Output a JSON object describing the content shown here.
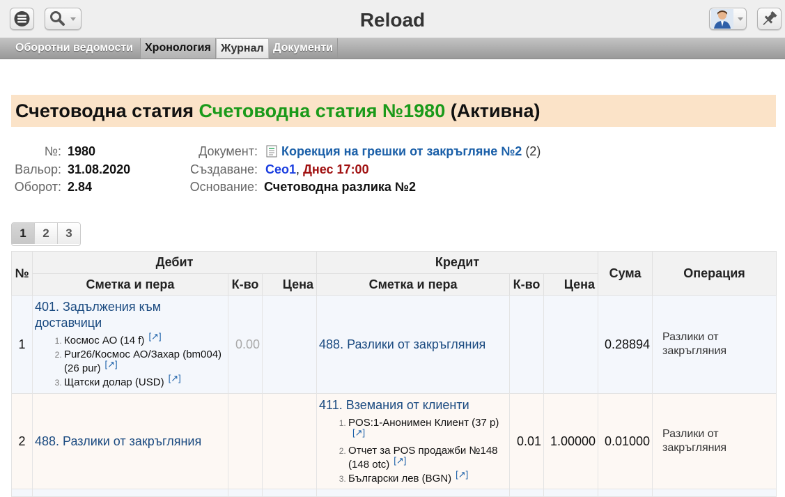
{
  "app": {
    "title": "Reload"
  },
  "tabs": [
    {
      "label": "Оборотни ведомости"
    },
    {
      "label": "Хронология"
    },
    {
      "label": "Журнал"
    },
    {
      "label": "Документи"
    }
  ],
  "heading": {
    "prefix": "Счетоводна статия",
    "name": "Счетоводна статия №1980",
    "status": "(Активна)"
  },
  "info": {
    "number_label": "№:",
    "number": "1980",
    "valor_label": "Вальор:",
    "valor": "31.08.2020",
    "turnover_label": "Оборот:",
    "turnover": "2.84",
    "document_label": "Документ:",
    "document": "Корекция на грешки от закръгляне №2",
    "document_count": "(2)",
    "created_label": "Създаване:",
    "created_user": "Ceo1",
    "created_sep": ",",
    "created_time": "Днес 17:00",
    "reason_label": "Основание:",
    "reason": "Счетоводна разлика №2"
  },
  "pager": {
    "pages": [
      "1",
      "2",
      "3"
    ],
    "active": "1"
  },
  "table": {
    "headers": {
      "no": "№",
      "debit": "Дебит",
      "credit": "Кредит",
      "amount": "Сума",
      "operation": "Операция",
      "account": "Сметка и пера",
      "qty": "К-во",
      "price": "Цена"
    },
    "rows": [
      {
        "no": "1",
        "debit_account": "401. Задължения към доставчици",
        "debit_items": [
          "Космос АО (14 f)",
          "Pur26/Космос АО/Захар (bm004) (26 pur)",
          "Щатски долар (USD)"
        ],
        "debit_qty": "0.00",
        "debit_price": "",
        "credit_account": "488. Разлики от закръгляния",
        "credit_qty": "",
        "credit_price": "",
        "amount": "0.28894",
        "operation": "Разлики от закръгляния"
      },
      {
        "no": "2",
        "debit_account": "488. Разлики от закръгляния",
        "debit_qty": "",
        "debit_price": "",
        "credit_account": "411. Вземания от клиенти",
        "credit_items": [
          "POS:1-Анонимен Клиент (37 p)",
          "Отчет за POS продажби №148 (148 otc)",
          "Български лев (BGN)"
        ],
        "credit_qty": "0.01",
        "credit_price": "1.00000",
        "amount": "0.01000",
        "operation": "Разлики от закръгляния"
      }
    ],
    "ext_link": "[↗]"
  }
}
